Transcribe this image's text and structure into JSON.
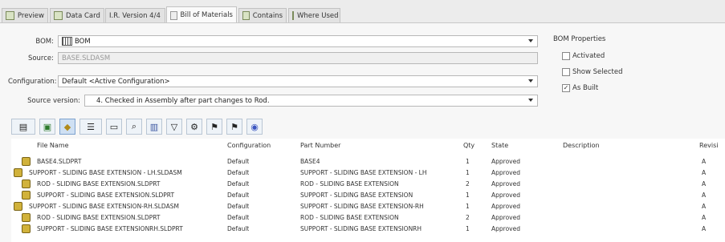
{
  "tabs": [
    {
      "label": "Preview"
    },
    {
      "label": "Data Card"
    },
    {
      "label": "I.R. Version 4/4"
    },
    {
      "label": "Bill of Materials"
    },
    {
      "label": "Contains"
    },
    {
      "label": "Where Used"
    }
  ],
  "form": {
    "bom_label": "BOM:",
    "bom_value": "BOM",
    "source_label": "Source:",
    "source_value": "BASE.SLDASM",
    "config_label": "Configuration:",
    "config_value": "Default <Active Configuration>",
    "srcver_label": "Source version:",
    "srcver_value": "4. Checked in Assembly after part changes to Rod."
  },
  "props": {
    "title": "BOM Properties",
    "activated": "Activated",
    "show_selected": "Show Selected",
    "as_built": "As Built",
    "as_built_checked": "✓"
  },
  "grid": {
    "headers": {
      "file": "File Name",
      "config": "Configuration",
      "part": "Part Number",
      "qty": "Qty",
      "state": "State",
      "desc": "Description",
      "rev": "Revisi"
    },
    "rows": [
      {
        "file": "BASE4.SLDPRT",
        "config": "Default",
        "part": "BASE4",
        "qty": "1",
        "state": "Approved",
        "rev": "A"
      },
      {
        "file": "SUPPORT - SLIDING BASE EXTENSION - LH.SLDASM",
        "config": "Default",
        "part": "SUPPORT - SLIDING BASE EXTENSION - LH",
        "qty": "1",
        "state": "Approved",
        "rev": "A"
      },
      {
        "file": "ROD - SLIDING BASE EXTENSION.SLDPRT",
        "config": "Default",
        "part": "ROD - SLIDING BASE EXTENSION",
        "qty": "2",
        "state": "Approved",
        "rev": "A"
      },
      {
        "file": "SUPPORT - SLIDING BASE EXTENSION.SLDPRT",
        "config": "Default",
        "part": "SUPPORT - SLIDING BASE EXTENSION",
        "qty": "1",
        "state": "Approved",
        "rev": "A"
      },
      {
        "file": "SUPPORT - SLIDING BASE EXTENSION-RH.SLDASM",
        "config": "Default",
        "part": "SUPPORT - SLIDING BASE EXTENSION-RH",
        "qty": "1",
        "state": "Approved",
        "rev": "A"
      },
      {
        "file": "ROD - SLIDING BASE EXTENSION.SLDPRT",
        "config": "Default",
        "part": "ROD - SLIDING BASE EXTENSION",
        "qty": "2",
        "state": "Approved",
        "rev": "A"
      },
      {
        "file": "SUPPORT - SLIDING BASE EXTENSIONRH.SLDPRT",
        "config": "Default",
        "part": "SUPPORT - SLIDING BASE EXTENSIONRH",
        "qty": "1",
        "state": "Approved",
        "rev": "A"
      }
    ]
  }
}
